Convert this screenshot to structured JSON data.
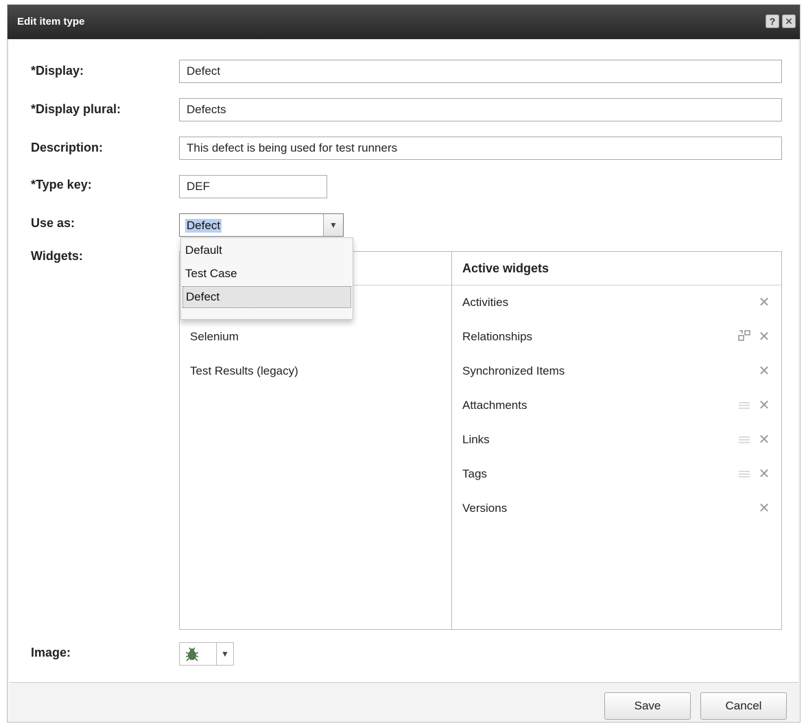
{
  "dialog": {
    "title": "Edit item type",
    "help_icon": "?",
    "close_icon": "✕"
  },
  "form": {
    "display_label": "*Display:",
    "display_value": "Defect",
    "display_plural_label": "*Display plural:",
    "display_plural_value": "Defects",
    "description_label": "Description:",
    "description_value": "This defect is being used for test runners",
    "type_key_label": "*Type key:",
    "type_key_value": "DEF",
    "use_as_label": "Use as:",
    "use_as_value": "Defect",
    "use_as_options": [
      "Default",
      "Test Case",
      "Defect"
    ],
    "widgets_label": "Widgets:",
    "image_label": "Image:"
  },
  "widgets": {
    "available": [
      "Selenium",
      "Test Results (legacy)"
    ],
    "active_header": "Active widgets",
    "active": [
      "Activities",
      "Relationships",
      "Synchronized Items",
      "Attachments",
      "Links",
      "Tags",
      "Versions"
    ]
  },
  "footer": {
    "save_label": "Save",
    "cancel_label": "Cancel"
  },
  "colors": {
    "titlebar": "#2f2f2f",
    "selection": "#b9cff0",
    "bug_icon": "#4f7a4f"
  }
}
